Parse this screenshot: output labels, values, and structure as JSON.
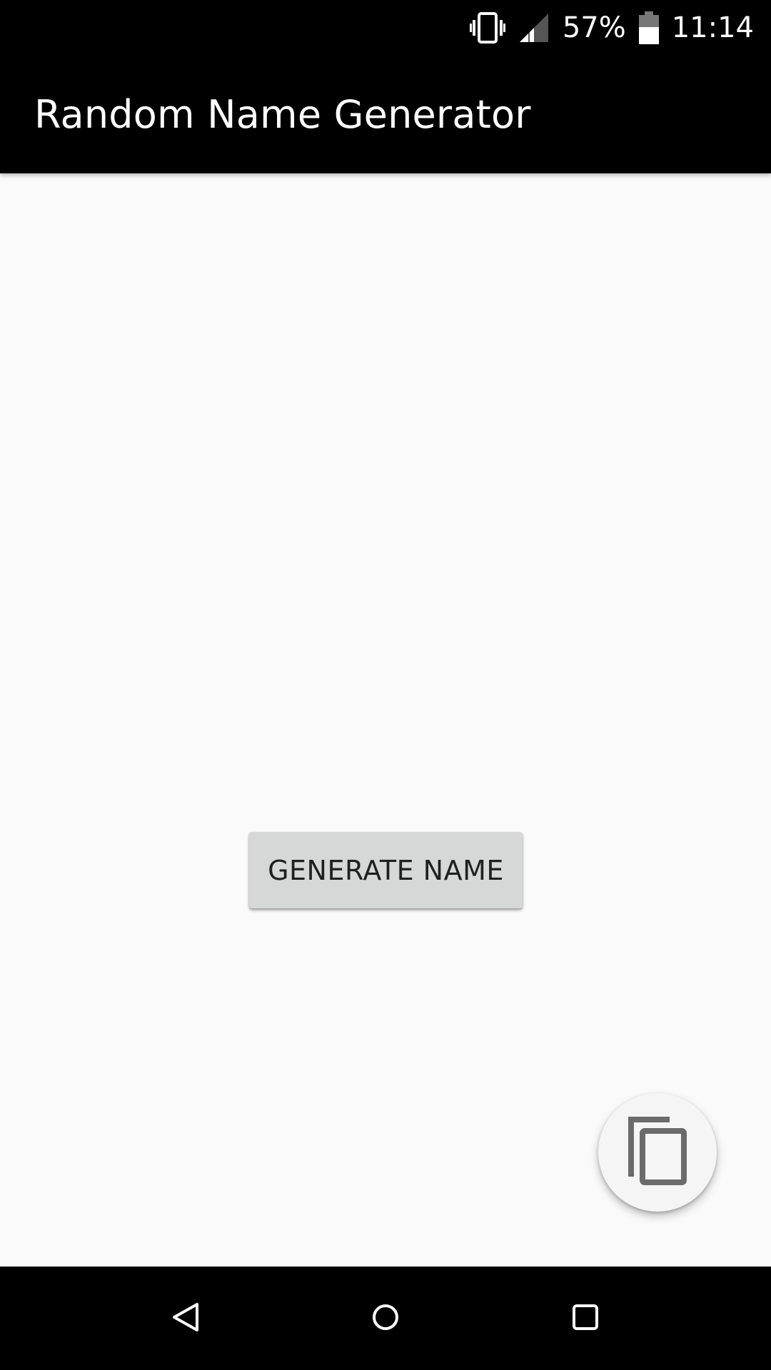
{
  "status_bar": {
    "icons": [
      "vibrate-icon",
      "signal-icon",
      "battery-icon"
    ],
    "battery_percent": "57%",
    "time": "11:14"
  },
  "app_bar": {
    "title": "Random Name Generator",
    "background": "#000000"
  },
  "main": {
    "generate_button_label": "GENERATE NAME",
    "fab_icon": "copy-icon"
  },
  "nav_bar": {
    "icons": [
      "back-icon",
      "home-icon",
      "recents-icon"
    ]
  },
  "colors": {
    "content_background": "#fafafa",
    "button_background": "#d6d7d7",
    "fab_background": "#f5f5f5",
    "icon_gray": "#6b6b6b"
  }
}
